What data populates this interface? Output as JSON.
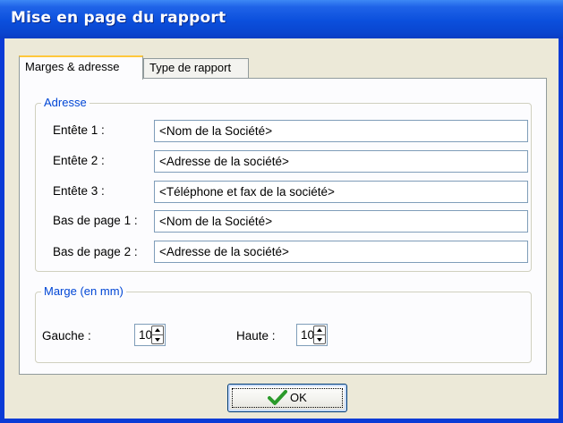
{
  "window": {
    "title": "Mise en page du rapport"
  },
  "tabs": [
    {
      "label": "Marges & adresse",
      "active": true
    },
    {
      "label": "Type de rapport",
      "active": false
    }
  ],
  "adresse": {
    "legend": "Adresse",
    "rows": [
      {
        "label": "Entête 1 :",
        "value": "<Nom de la Société>"
      },
      {
        "label": "Entête 2 :",
        "value": "<Adresse de la société>"
      },
      {
        "label": "Entête 3 :",
        "value": "<Téléphone et fax de la société>"
      },
      {
        "label": "Bas de page 1 :",
        "value": "<Nom de la Société>"
      },
      {
        "label": "Bas de page 2 :",
        "value": "<Adresse de la société>"
      }
    ]
  },
  "marge": {
    "legend": "Marge (en mm)",
    "gauche_label": "Gauche :",
    "gauche_value": "10",
    "haute_label": "Haute :",
    "haute_value": "10"
  },
  "ok_button": {
    "label": "OK",
    "icon": "checkmark-icon",
    "icon_color": "#2a9a2a"
  },
  "colors": {
    "title_bar": "#0b4fdc",
    "legend": "#0046d5",
    "tab_highlight": "#ffc83c",
    "dialog_bg": "#ece9d8"
  }
}
